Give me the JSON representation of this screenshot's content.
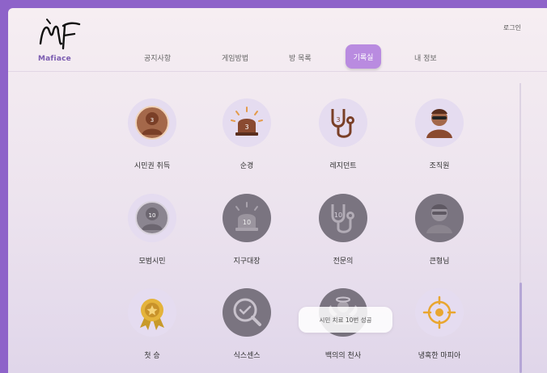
{
  "brand": {
    "name": "Mafiace",
    "logo_glyph": "MF"
  },
  "header": {
    "login_label": "로그인"
  },
  "nav": {
    "items": [
      "공지사항",
      "게임방법",
      "방 목록",
      "기록실",
      "내 정보"
    ],
    "active": "기록실"
  },
  "achievements": [
    {
      "label": "시민권 취득",
      "icon": "citizen-icon",
      "badge_number": "3",
      "unlocked": true
    },
    {
      "label": "순경",
      "icon": "siren-icon",
      "badge_number": "3",
      "unlocked": true
    },
    {
      "label": "레지던트",
      "icon": "stethoscope-icon",
      "badge_number": "3",
      "unlocked": true
    },
    {
      "label": "조직원",
      "icon": "mafia-member-icon",
      "badge_number": "",
      "unlocked": true
    },
    {
      "label": "모범시민",
      "icon": "citizen-icon",
      "badge_number": "10",
      "unlocked": false
    },
    {
      "label": "지구대장",
      "icon": "siren-icon",
      "badge_number": "10",
      "unlocked": false
    },
    {
      "label": "전문의",
      "icon": "stethoscope-icon",
      "badge_number": "10",
      "unlocked": false
    },
    {
      "label": "큰형님",
      "icon": "mafia-boss-icon",
      "badge_number": "",
      "unlocked": false
    },
    {
      "label": "첫 승",
      "icon": "medal-icon",
      "badge_number": "",
      "unlocked": true
    },
    {
      "label": "식스센스",
      "icon": "magnifier-check-icon",
      "badge_number": "",
      "unlocked": false
    },
    {
      "label": "백의의 천사",
      "icon": "angel-icon",
      "badge_number": "",
      "unlocked": false
    },
    {
      "label": "냉혹한 마피아",
      "icon": "crosshair-icon",
      "badge_number": "",
      "unlocked": true
    }
  ],
  "toast": {
    "message": "시민 치료 10번 성공"
  },
  "colors": {
    "frame": "#8e63c9",
    "nav_active": "#b98be0",
    "badge_on": "#e5dcf0",
    "badge_off": "#7a7480"
  }
}
